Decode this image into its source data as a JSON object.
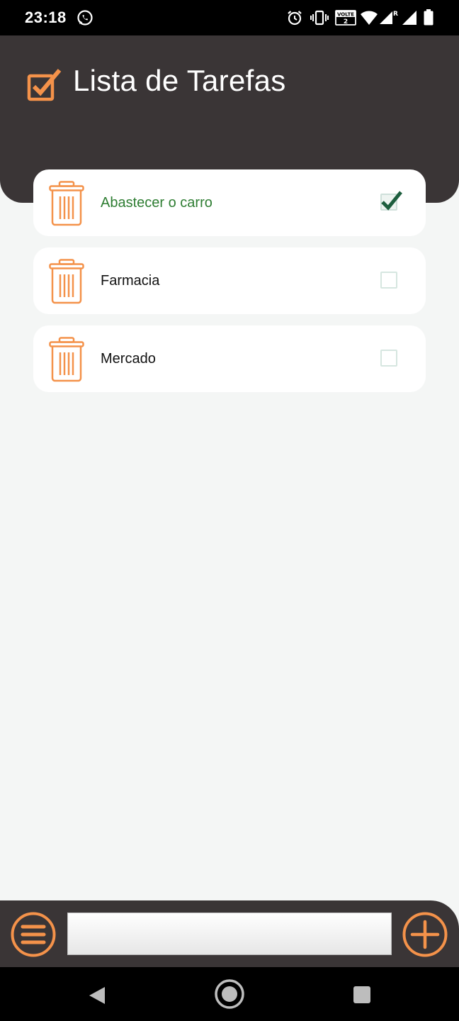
{
  "status_bar": {
    "time": "23:18",
    "icons": [
      "whatsapp-icon",
      "alarm-icon",
      "vibrate-icon",
      "volte-icon",
      "wifi-icon",
      "signal-icon",
      "signal-roaming-icon",
      "battery-icon"
    ]
  },
  "header": {
    "title": "Lista de Tarefas",
    "icon": "checkbox-checked-icon"
  },
  "tasks": [
    {
      "text": "Abastecer o carro",
      "done": true
    },
    {
      "text": "Farmacia",
      "done": false
    },
    {
      "text": "Mercado",
      "done": false
    }
  ],
  "bottom_bar": {
    "input_value": "",
    "input_placeholder": "",
    "menu_icon": "menu-icon",
    "add_icon": "add-icon"
  },
  "colors": {
    "accent": "#f4924a",
    "header_bg": "#3a3536",
    "done_text": "#2e7d32",
    "check_green": "#1d5e3e",
    "page_bg": "#f4f6f5"
  }
}
